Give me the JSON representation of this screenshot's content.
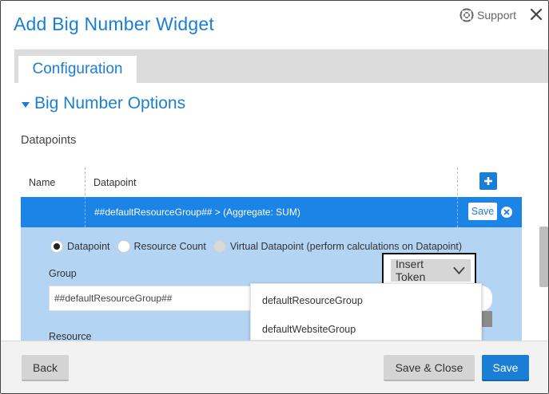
{
  "dialog": {
    "title": "Add Big Number Widget",
    "support_label": "Support"
  },
  "tabs": [
    {
      "label": "Configuration",
      "active": true
    }
  ],
  "section": {
    "title": "Big Number Options"
  },
  "datapoints": {
    "label": "Datapoints",
    "columns": [
      "Name",
      "Datapoint"
    ],
    "rows": [
      {
        "name": "",
        "datapoint": "##defaultResourceGroup## > (Aggregate: SUM)",
        "save_label": "Save"
      }
    ]
  },
  "edit": {
    "radio_options": [
      {
        "label": "Datapoint",
        "checked": true,
        "disabled": false
      },
      {
        "label": "Resource Count",
        "checked": false,
        "disabled": false
      },
      {
        "label": "Virtual Datapoint (perform calculations on Datapoint)",
        "checked": false,
        "disabled": true
      }
    ],
    "group_label": "Group",
    "group_value": "##defaultResourceGroup##",
    "resource_label": "Resource",
    "insert_token_label": "Insert Token"
  },
  "token_dropdown": {
    "items": [
      "defaultResourceGroup",
      "defaultWebsiteGroup"
    ]
  },
  "footer": {
    "back_label": "Back",
    "save_close_label": "Save & Close",
    "save_label": "Save"
  },
  "colors": {
    "accent": "#1a7fd4",
    "selected_row": "#1b84e6",
    "edit_panel": "#b3d4f3"
  }
}
